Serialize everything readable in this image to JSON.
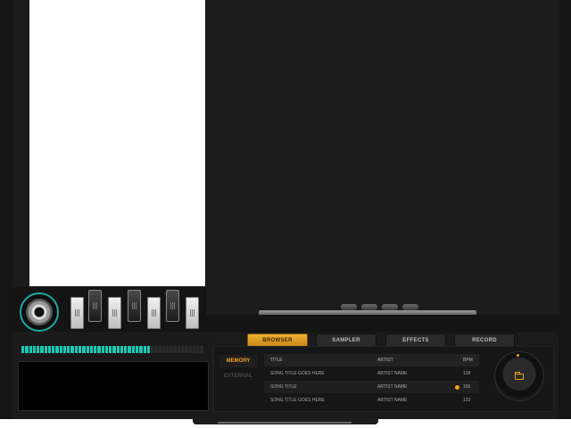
{
  "tabs": [
    {
      "label": "BROWSER",
      "active": true
    },
    {
      "label": "SAMPLER",
      "active": false
    },
    {
      "label": "EFFECTS",
      "active": false
    },
    {
      "label": "RECORD",
      "active": false
    }
  ],
  "side_nav": {
    "memory_label": "MEMORY",
    "external_label": "EXTERNAL"
  },
  "list": {
    "columns": {
      "title": "TITLE",
      "artist": "ARTIST",
      "bpm": "BPM"
    },
    "rows": [
      {
        "title": "SONG TITLE GOES HERE",
        "artist": "ARTIST NAME",
        "bpm": "128",
        "playing": false
      },
      {
        "title": "SONG TITLE",
        "artist": "ARTIST NAME",
        "bpm": "156",
        "playing": true
      },
      {
        "title": "SONG TITLE GOES HERE",
        "artist": "ARTIST NAME",
        "bpm": "123",
        "playing": false
      }
    ]
  },
  "level_meter": {
    "level": 0.7
  },
  "colors": {
    "accent": "#f0a020",
    "teal": "#19c9b3"
  },
  "icons": [
    "jog-wheel-icon",
    "folder-icon"
  ]
}
